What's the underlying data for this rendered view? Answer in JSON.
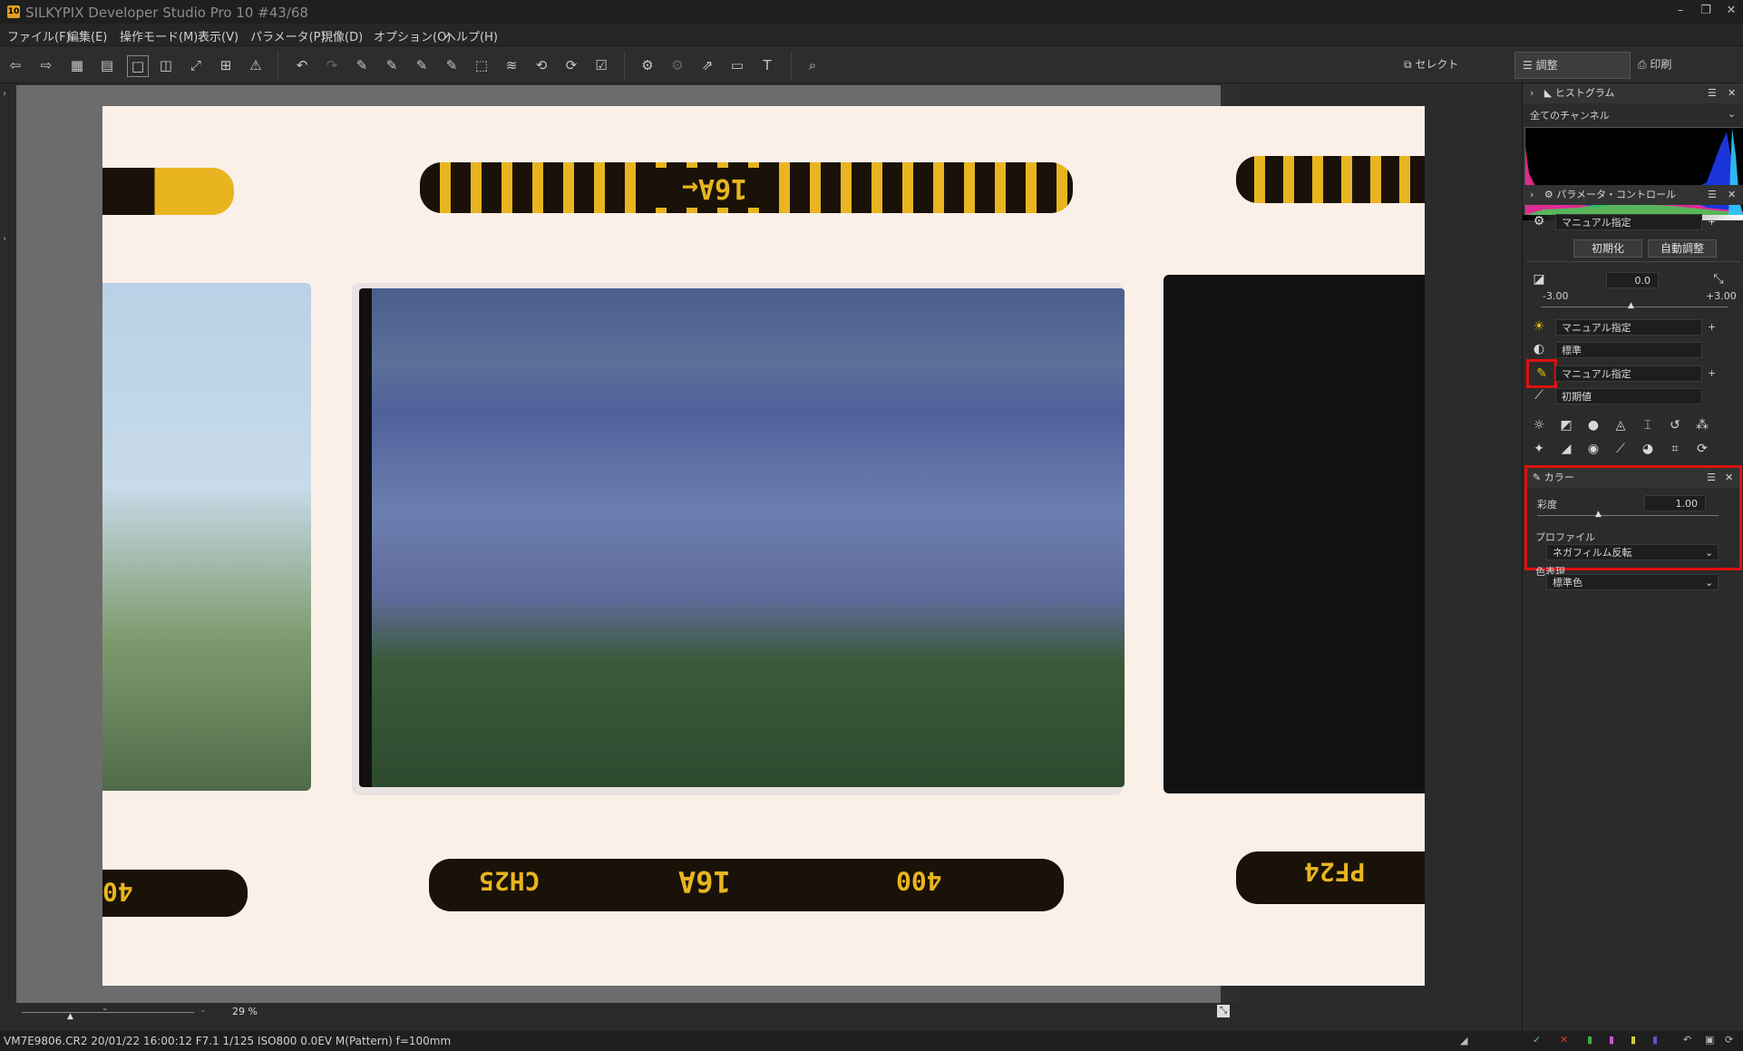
{
  "window": {
    "title": "SILKYPIX Developer Studio Pro 10   #43/68",
    "icon_text": "10"
  },
  "menu": [
    "ファイル(F)",
    "編集(E)",
    "操作モード(M)",
    "表示(V)",
    "パラメータ(P)",
    "現像(D)",
    "オプション(O)",
    "ヘルプ(H)"
  ],
  "modes": {
    "select": "セレクト",
    "adjust": "調整",
    "print": "印刷"
  },
  "histogram": {
    "title": "ヒストグラム",
    "channel": "全てのチャンネル"
  },
  "param_control": {
    "title": "パラメータ・コントロール",
    "preset": "マニュアル指定",
    "init_button": "初期化",
    "auto_button": "自動調整",
    "exposure": {
      "value": "0.0",
      "min": "-3.00",
      "max": "+3.00"
    },
    "white_balance": "マニュアル指定",
    "tone": "標準",
    "color": "マニュアル指定",
    "sharpness": "初期値"
  },
  "color_panel": {
    "title": "カラー",
    "saturation_label": "彩度",
    "saturation_value": "1.00",
    "profile_label": "プロファイル",
    "profile_value": "ネガフィルム反転",
    "color_expression_label": "色表現",
    "color_expression_value": "標準色"
  },
  "film": {
    "top_code": "16A←",
    "bottom_code1": "CH25",
    "bottom_code2": "16A",
    "bottom_code3": "400",
    "bottom_left": "40",
    "bottom_right": "PF24"
  },
  "zoom": {
    "value": "29",
    "unit": "%"
  },
  "status": {
    "text": "VM7E9806.CR2 20/01/22 16:00:12 F7.1 1/125 ISO800  0.0EV M(Pattern) f=100mm"
  },
  "colors": {
    "accent_red": "#e01010",
    "film_orange": "#e8b520"
  }
}
